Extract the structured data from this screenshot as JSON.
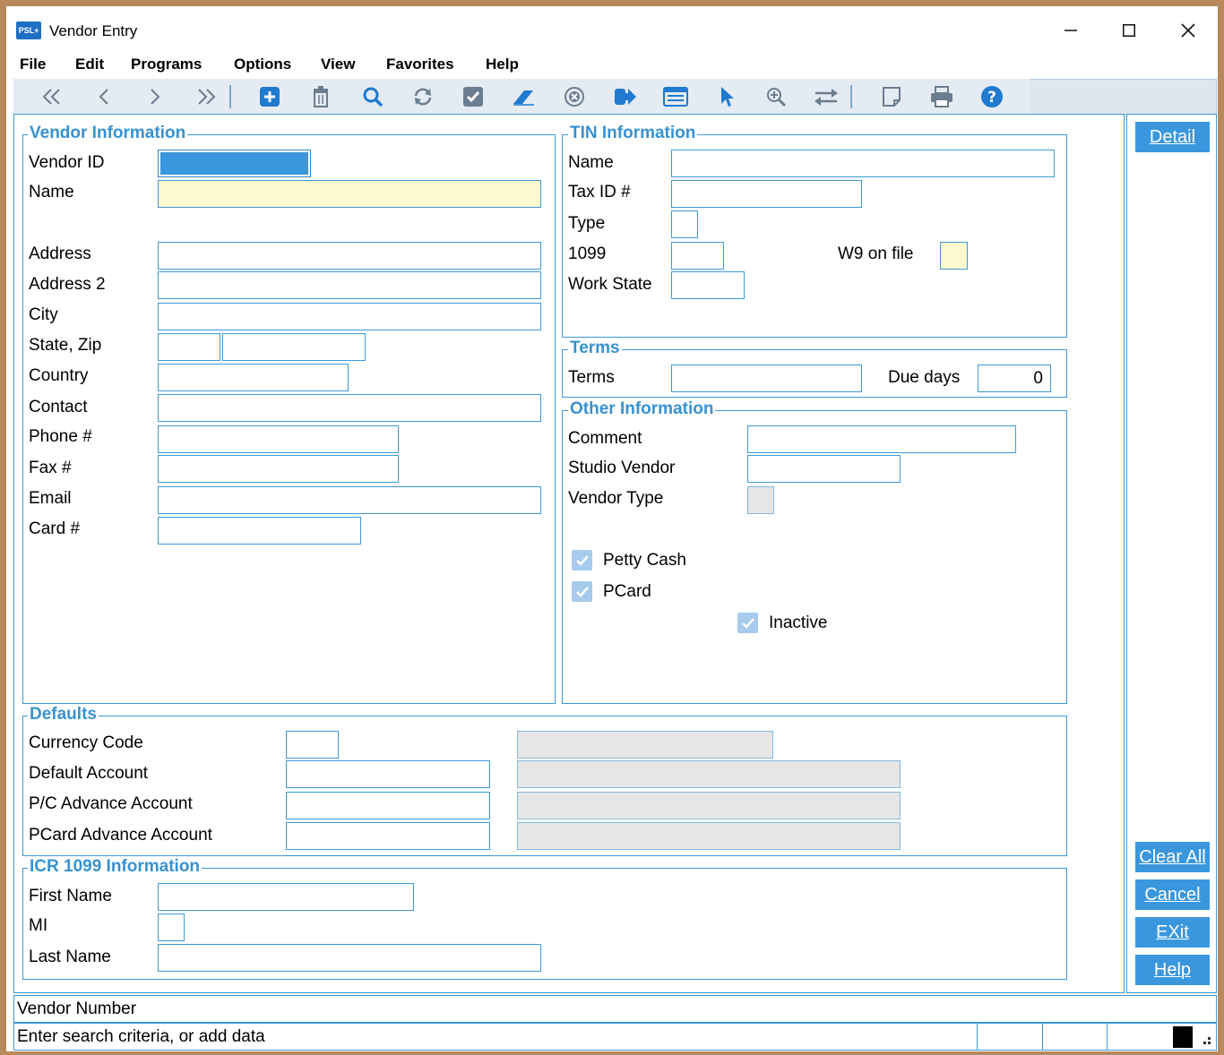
{
  "window": {
    "title": "Vendor Entry",
    "app_icon_text": "PSL+"
  },
  "menu": [
    "File",
    "Edit",
    "Programs",
    "Options",
    "View",
    "Favorites",
    "Help"
  ],
  "toolbar": {
    "icons": [
      "first-record-icon",
      "previous-record-icon",
      "next-record-icon",
      "last-record-icon",
      "add-icon",
      "delete-icon",
      "search-icon",
      "refresh-icon",
      "save-icon",
      "eraser-icon",
      "cancel-icon",
      "go-icon",
      "list-icon",
      "pointer-icon",
      "zoom-icon",
      "transfer-icon",
      "note-icon",
      "print-icon",
      "help-icon"
    ]
  },
  "vendor_info": {
    "title": "Vendor Information",
    "labels": {
      "vendor_id": "Vendor ID",
      "name": "Name",
      "address": "Address",
      "address2": "Address 2",
      "city": "City",
      "state_zip": "State, Zip",
      "country": "Country",
      "contact": "Contact",
      "phone": "Phone #",
      "fax": "Fax  #",
      "email": "Email",
      "card": "Card #"
    },
    "values": {
      "vendor_id": "",
      "name": "",
      "address": "",
      "address2": "",
      "city": "",
      "state": "",
      "zip": "",
      "country": "",
      "contact": "",
      "phone": "",
      "fax": "",
      "email": "",
      "card": ""
    }
  },
  "tin_info": {
    "title": "TIN Information",
    "labels": {
      "name": "Name",
      "tax_id": "Tax ID #",
      "type": "Type",
      "f1099": "1099",
      "work_state": "Work State",
      "w9": "W9 on file"
    },
    "values": {
      "name": "",
      "tax_id": "",
      "type": "",
      "f1099": "",
      "work_state": ""
    }
  },
  "terms": {
    "title": "Terms",
    "labels": {
      "terms": "Terms",
      "due_days": "Due days"
    },
    "values": {
      "terms": "",
      "due_days": "0"
    }
  },
  "other_info": {
    "title": "Other Information",
    "labels": {
      "comment": "Comment",
      "studio_vendor": "Studio Vendor",
      "vendor_type": "Vendor Type"
    },
    "checkboxes": {
      "petty_cash": "Petty Cash",
      "pcard": "PCard",
      "inactive": "Inactive"
    },
    "checked": {
      "petty_cash": true,
      "pcard": true,
      "inactive": true
    }
  },
  "defaults": {
    "title": "Defaults",
    "labels": {
      "currency": "Currency Code",
      "default_account": "Default Account",
      "pc_advance": "P/C Advance Account",
      "pcard_advance": "PCard Advance Account"
    }
  },
  "icr1099": {
    "title": "ICR 1099 Information",
    "labels": {
      "first_name": "First Name",
      "mi": "MI",
      "last_name": "Last Name"
    }
  },
  "side_buttons": {
    "detail": "Detail",
    "clear_all": "Clear All",
    "cancel": "Cancel",
    "exit": "EXit",
    "help": "Help"
  },
  "status": {
    "field_name": "Vendor Number",
    "hint": "Enter search criteria, or add data"
  },
  "colors": {
    "accent": "#3a97dd",
    "border": "#3c9ad6",
    "required_field": "#fdf8cd",
    "readonly_field": "#e6e6e6",
    "frame": "#b8895a"
  }
}
